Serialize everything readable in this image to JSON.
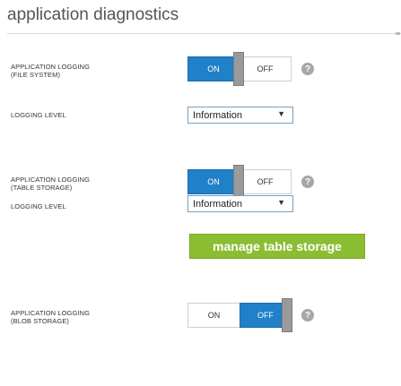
{
  "page": {
    "title": "application diagnostics"
  },
  "file_system": {
    "label_line1": "APPLICATION LOGGING",
    "label_line2": "(FILE SYSTEM)",
    "toggle_on": "ON",
    "toggle_off": "OFF",
    "selected": "ON",
    "help": "?"
  },
  "file_system_level": {
    "label": "LOGGING LEVEL",
    "value": "Information",
    "arrow": "▼"
  },
  "table_storage": {
    "label_line1": "APPLICATION LOGGING",
    "label_line2": "(TABLE STORAGE)",
    "toggle_on": "ON",
    "toggle_off": "OFF",
    "selected": "ON",
    "help": "?"
  },
  "table_storage_level": {
    "label": "LOGGING LEVEL",
    "value": "Information",
    "arrow": "▼"
  },
  "manage_button": {
    "label": "manage table storage"
  },
  "blob_storage": {
    "label_line1": "APPLICATION LOGGING",
    "label_line2": "(BLOB STORAGE)",
    "toggle_on": "ON",
    "toggle_off": "OFF",
    "selected": "OFF",
    "help": "?"
  },
  "colors": {
    "toggle_selected": "#2080c8",
    "manage_button": "#8bbd33",
    "help_icon": "#a7a7a7"
  }
}
